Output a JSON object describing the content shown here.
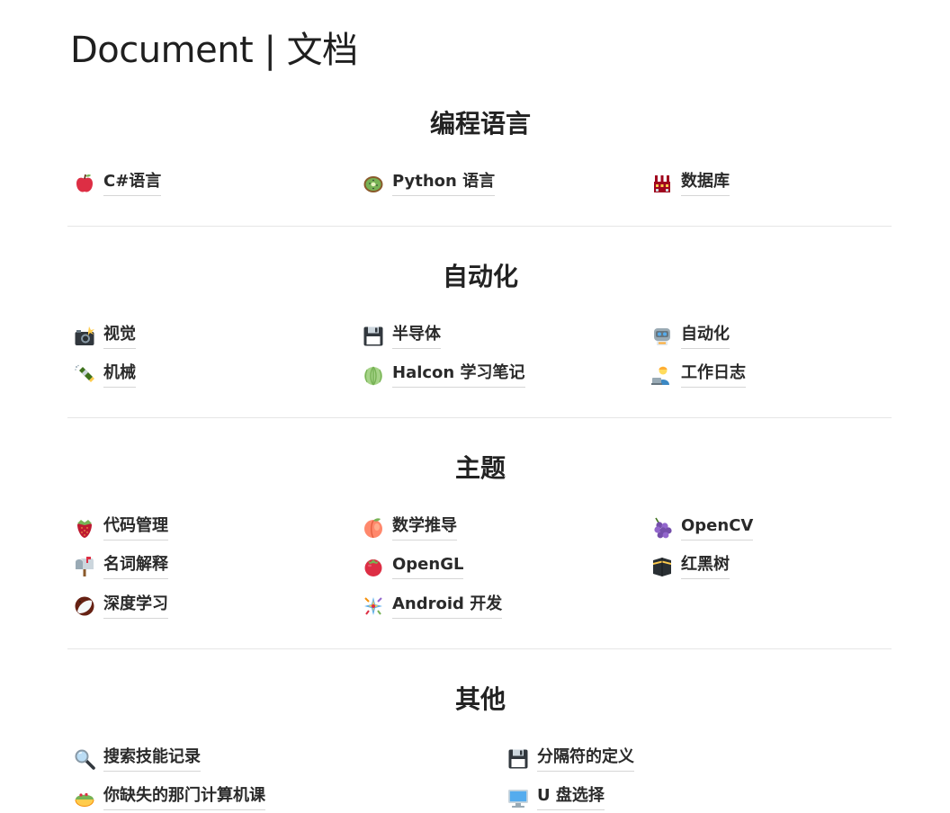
{
  "page": {
    "title": "Document | 文档"
  },
  "sections": [
    {
      "title": "编程语言",
      "items": [
        {
          "label": "C#语言",
          "icon": "apple-icon"
        },
        {
          "label": "Python 语言",
          "icon": "kiwi-icon"
        },
        {
          "label": "数据库",
          "icon": "factory-icon"
        }
      ]
    },
    {
      "title": "自动化",
      "items": [
        {
          "label": "视觉",
          "icon": "camera-flash-icon"
        },
        {
          "label": "半导体",
          "icon": "floppy-disk-icon"
        },
        {
          "label": "自动化",
          "icon": "robot-icon"
        },
        {
          "label": "机械",
          "icon": "champagne-icon"
        },
        {
          "label": "Halcon 学习笔记",
          "icon": "melon-icon"
        },
        {
          "label": "工作日志",
          "icon": "technologist-icon"
        }
      ]
    },
    {
      "title": "主题",
      "items": [
        {
          "label": "代码管理",
          "icon": "strawberry-icon"
        },
        {
          "label": "数学推导",
          "icon": "peach-icon"
        },
        {
          "label": "OpenCV",
          "icon": "grapes-icon"
        },
        {
          "label": "名词解释",
          "icon": "mailbox-icon"
        },
        {
          "label": "OpenGL",
          "icon": "tomato-icon"
        },
        {
          "label": "红黑树",
          "icon": "kaaba-icon"
        },
        {
          "label": "深度学习",
          "icon": "coconut-icon"
        },
        {
          "label": "Android 开发",
          "icon": "pinata-icon"
        }
      ]
    },
    {
      "title": "其他",
      "items": [
        {
          "label": "搜索技能记录",
          "icon": "magnifier-icon"
        },
        {
          "label": "分隔符的定义",
          "icon": "floppy-disk-icon"
        },
        {
          "label": "你缺失的那门计算机课",
          "icon": "taco-icon"
        },
        {
          "label": "U 盘选择",
          "icon": "computer-icon"
        }
      ]
    }
  ]
}
